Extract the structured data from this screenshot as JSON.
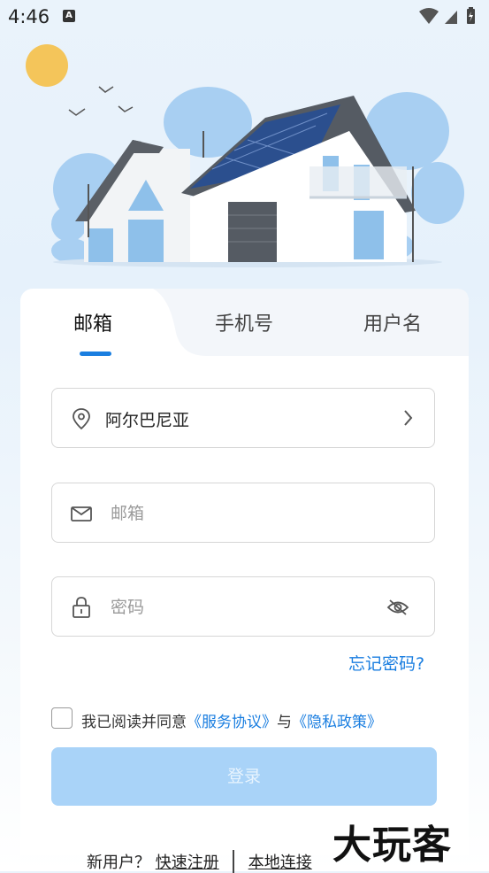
{
  "status_bar": {
    "time": "4:46",
    "notification_icon": "A"
  },
  "tabs": [
    {
      "label": "邮箱",
      "active": true
    },
    {
      "label": "手机号",
      "active": false
    },
    {
      "label": "用户名",
      "active": false
    }
  ],
  "form": {
    "country": {
      "icon": "location-pin-icon",
      "value": "阿尔巴尼亚"
    },
    "email": {
      "icon": "mail-icon",
      "placeholder": "邮箱"
    },
    "password": {
      "icon": "lock-icon",
      "placeholder": "密码"
    },
    "forgot_password": "忘记密码?",
    "agreement": {
      "prefix": "我已阅读并同意",
      "service_link": "《服务协议》",
      "conjunction": "与",
      "privacy_link": "《隐私政策》"
    },
    "login_button": "登录"
  },
  "footer": {
    "new_user": "新用户？",
    "register_link": "快速注册",
    "local_link": "本地连接"
  },
  "watermark": "大玩客",
  "colors": {
    "accent": "#1a7ee0",
    "button_disabled": "#a9d3f8"
  }
}
